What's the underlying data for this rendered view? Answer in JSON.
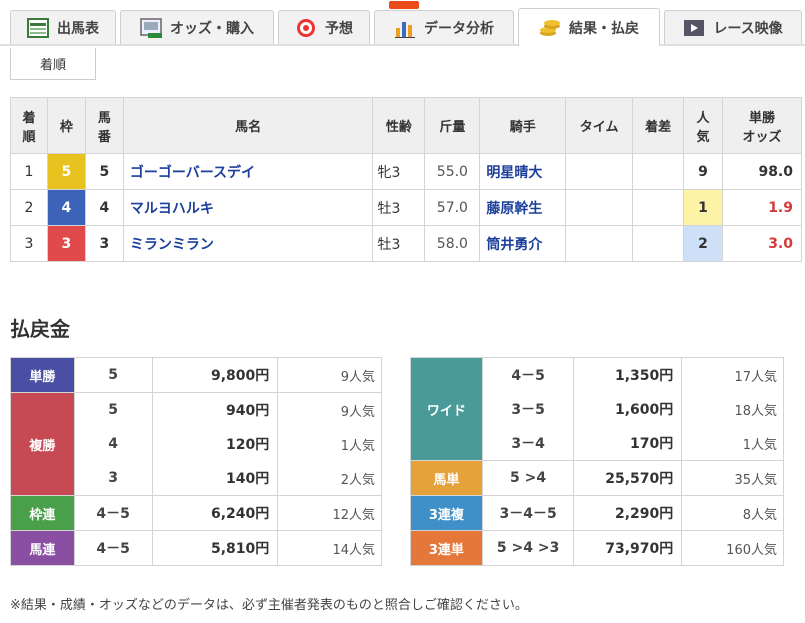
{
  "tabs": [
    {
      "label": "出馬表",
      "icon": "table-icon"
    },
    {
      "label": "オッズ・購入",
      "icon": "ipat-icon"
    },
    {
      "label": "予想",
      "icon": "target-icon"
    },
    {
      "label": "データ分析",
      "icon": "bar-chart-icon"
    },
    {
      "label": "結果・払戻",
      "icon": "coins-icon"
    },
    {
      "label": "レース映像",
      "icon": "video-icon"
    }
  ],
  "subtab": "着順",
  "result": {
    "headers": [
      "着順",
      "枠",
      "馬番",
      "馬名",
      "性齢",
      "斤量",
      "騎手",
      "タイム",
      "着差",
      "人気",
      "単勝オッズ"
    ],
    "rows": [
      {
        "rank": "1",
        "waku": "5",
        "umaban": "5",
        "name": "ゴーゴーバースデイ",
        "sex": "牝3",
        "weight": "55.0",
        "jockey": "明星晴大",
        "time": "",
        "margin": "",
        "pop": "9",
        "odds": "98.0"
      },
      {
        "rank": "2",
        "waku": "4",
        "umaban": "4",
        "name": "マルヨハルキ",
        "sex": "牡3",
        "weight": "57.0",
        "jockey": "藤原幹生",
        "time": "",
        "margin": "",
        "pop": "1",
        "odds": "1.9"
      },
      {
        "rank": "3",
        "waku": "3",
        "umaban": "3",
        "name": "ミランミラン",
        "sex": "牡3",
        "weight": "58.0",
        "jockey": "筒井勇介",
        "time": "",
        "margin": "",
        "pop": "2",
        "odds": "3.0"
      }
    ]
  },
  "payout": {
    "title": "払戻金",
    "left": {
      "tansho": {
        "label": "単勝",
        "rows": [
          {
            "num": "5",
            "yen": "9,800円",
            "ninki": "9人気"
          }
        ]
      },
      "fukusho": {
        "label": "複勝",
        "rows": [
          {
            "num": "5",
            "yen": "940円",
            "ninki": "9人気"
          },
          {
            "num": "4",
            "yen": "120円",
            "ninki": "1人気"
          },
          {
            "num": "3",
            "yen": "140円",
            "ninki": "2人気"
          }
        ]
      },
      "wakuren": {
        "label": "枠連",
        "rows": [
          {
            "num": "4－5",
            "yen": "6,240円",
            "ninki": "12人気"
          }
        ]
      },
      "umaren": {
        "label": "馬連",
        "rows": [
          {
            "num": "4－5",
            "yen": "5,810円",
            "ninki": "14人気"
          }
        ]
      }
    },
    "right": {
      "wide": {
        "label": "ワイド",
        "rows": [
          {
            "num": "4－5",
            "yen": "1,350円",
            "ninki": "17人気"
          },
          {
            "num": "3－5",
            "yen": "1,600円",
            "ninki": "18人気"
          },
          {
            "num": "3－4",
            "yen": "170円",
            "ninki": "1人気"
          }
        ]
      },
      "umatan": {
        "label": "馬単",
        "rows": [
          {
            "num": "5 >4",
            "yen": "25,570円",
            "ninki": "35人気"
          }
        ]
      },
      "sanrenpuku": {
        "label": "3連複",
        "rows": [
          {
            "num": "3－4－5",
            "yen": "2,290円",
            "ninki": "8人気"
          }
        ]
      },
      "sanrentan": {
        "label": "3連単",
        "rows": [
          {
            "num": "5 >4 >3",
            "yen": "73,970円",
            "ninki": "160人気"
          }
        ]
      }
    }
  },
  "note": "※結果・成績・オッズなどのデータは、必ず主催者発表のものと照合しご確認ください。",
  "colors": {
    "waku5": "#e8c21f",
    "waku4": "#3d63b8",
    "waku3": "#e04a4a",
    "tansho": "#4a4fa3",
    "fukusho": "#c64a54",
    "wakuren": "#4aa04a",
    "umaren": "#8a4fa3",
    "wide": "#4a9a9a",
    "umatan": "#e6a23a",
    "sanrenpuku": "#3f8fc8",
    "sanrentan": "#e6773a"
  }
}
